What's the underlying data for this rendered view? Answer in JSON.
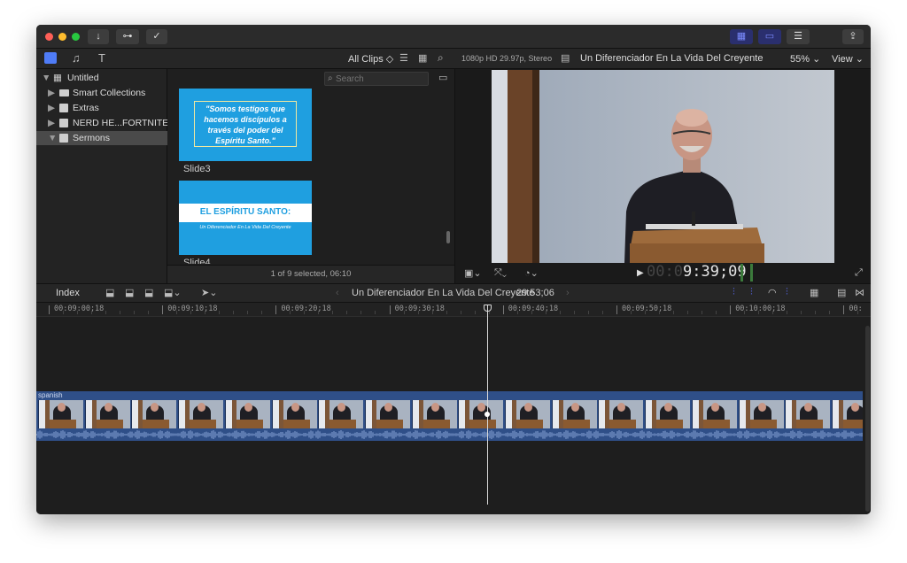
{
  "toolbar": {
    "import_icon": "↓",
    "keyword_icon": "⊶",
    "check_icon": "✓",
    "share_icon": "⇪"
  },
  "browser_header": {
    "filter": "All Clips ◇",
    "search_placeholder": "Search",
    "status": "1 of 9 selected, 06:10"
  },
  "library": {
    "items": [
      {
        "label": "Untitled"
      },
      {
        "label": "Smart Collections"
      },
      {
        "label": "Extras"
      },
      {
        "label": "NERD HE...FORTNITE"
      },
      {
        "label": "Sermons"
      }
    ]
  },
  "clips": [
    {
      "label": "Slide3",
      "thumb_text": "\"Somos testigos que hacemos discípulos a través del poder del Espíritu Santo.\""
    },
    {
      "label": "Slide4",
      "thumb_title": "EL ESPÍRITU SANTO:",
      "thumb_sub": "Un Diferenciador En La Vida Del Creyente"
    }
  ],
  "viewer": {
    "format": "1080p HD 29.97p, Stereo",
    "title": "Un Diferenciador En La Vida Del Creyente",
    "zoom": "55% ⌄",
    "view": "View ⌄",
    "timecode_dim": "00:0",
    "timecode": "9:39;09"
  },
  "timeline": {
    "index_label": "Index",
    "project_name": "Un Diferenciador En La Vida Del Creyente",
    "duration": "29:53;06",
    "clip_label": "spanish",
    "ruler": [
      "00:09:00;18",
      "00:09:10;18",
      "00:09:20;18",
      "00:09:30;18",
      "00:09:40;18",
      "00:09:50;18",
      "00:10:00;18",
      "00:"
    ],
    "frames": 18
  },
  "colors": {
    "accent": "#5a6cf5",
    "clip_blue": "#2f4f88",
    "slide_blue": "#1f9fe0"
  }
}
